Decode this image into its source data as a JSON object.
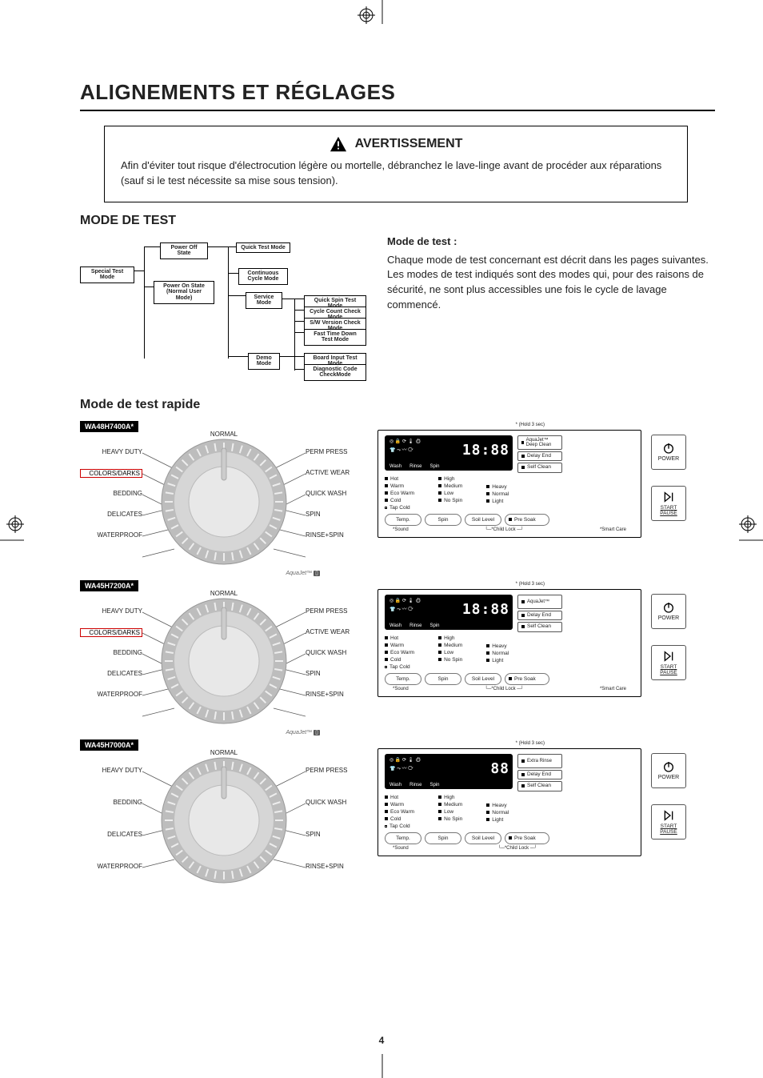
{
  "page_title": "ALIGNEMENTS ET RÉGLAGES",
  "warning": {
    "heading": "AVERTISSEMENT",
    "text": "Afin d'éviter tout risque d'électrocution légère ou mortelle, débranchez le lave-linge avant de procéder aux réparations (sauf si le test nécessite sa mise sous tension)."
  },
  "section_test_mode": "MODE DE TEST",
  "flowchart": {
    "special": "Special Test Mode",
    "power_off": "Power Off State",
    "power_on": "Power On State\n(Normal User Mode)",
    "quick": "Quick Test Mode",
    "continuous": "Continuous Cycle Mode",
    "service": "Service Mode",
    "demo": "Demo Mode",
    "sub": [
      "Quick Spin Test Mode",
      "Cycle Count Check Mode",
      "S/W Version Check Mode",
      "Fast Time Down Test Mode",
      "Board Input Test Mode",
      "Diagnostic Code CheckMode"
    ]
  },
  "desc_heading": "Mode de test :",
  "desc_text": "Chaque mode de test concernant est décrit dans les pages suivantes.  Les modes de test indiqués sont des modes qui, pour des raisons de sécurité, ne sont plus accessibles une fois le cycle de lavage commencé.",
  "section_quick": "Mode de test rapide",
  "models": [
    {
      "id": "WA48H7400A*",
      "has_colors": true,
      "has_active": true,
      "seg": "18:88",
      "side0": "AquaJet™ Deep Clean",
      "has_smart": true
    },
    {
      "id": "WA45H7200A*",
      "has_colors": true,
      "has_active": true,
      "seg": "18:88",
      "side0": "AquaJet™",
      "has_smart": true
    },
    {
      "id": "WA45H7000A*",
      "has_colors": false,
      "has_active": false,
      "seg": "88",
      "side0": "Extra Rinse",
      "has_smart": false
    }
  ],
  "dial_labels": {
    "normal": "NORMAL",
    "heavy": "HEAVY DUTY",
    "colors": "COLORS/DARKS",
    "bedding": "BEDDING",
    "delicates": "DELICATES",
    "waterproof": "WATERPROOF",
    "perm": "PERM PRESS",
    "active": "ACTIVE WEAR",
    "quick": "QUICK WASH",
    "spin": "SPIN",
    "rinse_spin": "RINSE+SPIN",
    "aquajet": "AquaJet™"
  },
  "ctrl": {
    "hold": "* (Hold 3 sec)",
    "wrs": [
      "Wash",
      "Rinse",
      "Spin"
    ],
    "temp_col": [
      "Hot",
      "Warm",
      "Eco Warm",
      "Cold"
    ],
    "tap": "Tap Cold",
    "spin_col": [
      "High",
      "Medium",
      "Low",
      "No Spin"
    ],
    "soil_col": [
      "Heavy",
      "Normal",
      "Light"
    ],
    "pills": [
      "Temp.",
      "Spin",
      "Soil Level"
    ],
    "presoak": "Pre Soak",
    "delay": "Delay End",
    "self": "Self Clean",
    "foot_sound": "*Sound",
    "foot_child": "└─*Child Lock ─┘",
    "foot_smart": "*Smart Care"
  },
  "power": "POWER",
  "start_pause": "START PAUSE",
  "page_num": "4"
}
